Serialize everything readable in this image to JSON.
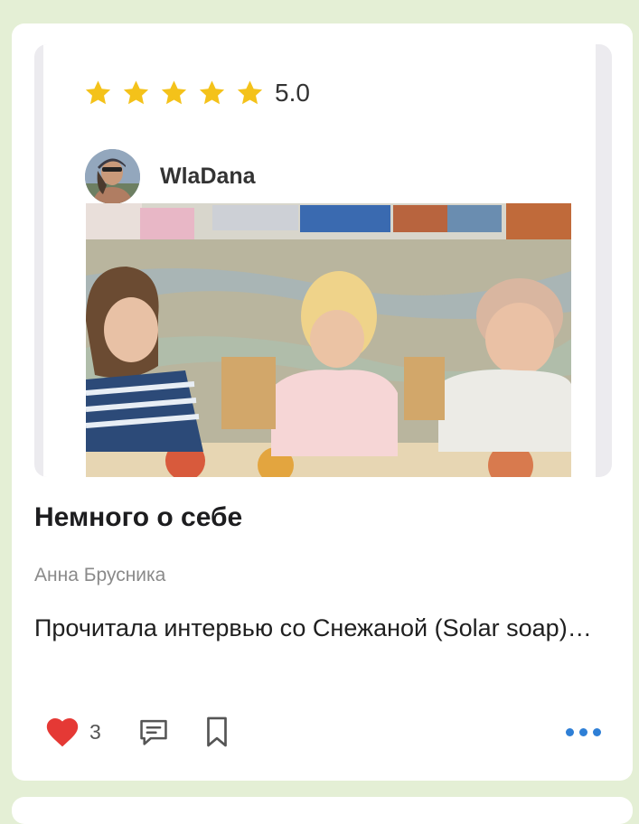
{
  "post": {
    "rating": {
      "stars": 5,
      "value_label": "5.0"
    },
    "reviewer": {
      "name": "WlaDana",
      "avatar_icon": "user-avatar-icon"
    },
    "title": "Немного о себе",
    "author": "Анна Брусника",
    "excerpt": "Прочитала интервью со Снежаной (Solar soap)…",
    "likes": "3",
    "colors": {
      "star": "#f4c21a",
      "heart": "#e53935",
      "accent": "#2e7fd6",
      "background": "#e4efd5"
    }
  }
}
